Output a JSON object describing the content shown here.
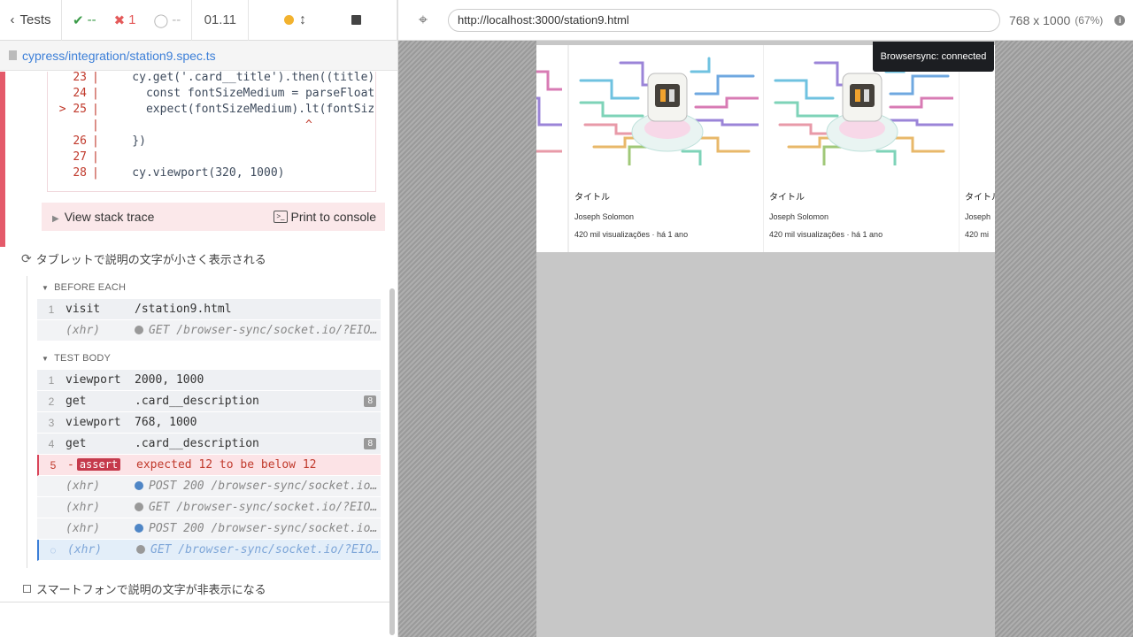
{
  "reporter": {
    "tests_label": "Tests",
    "passed": "--",
    "failed": "1",
    "pending": "--",
    "duration": "01.11",
    "spec_file": "cypress/integration/station9.spec.ts"
  },
  "error": {
    "code_lines": [
      {
        "num": "23",
        "arrow": "",
        "text": "    cy.get('.card__title').then((title)"
      },
      {
        "num": "24",
        "arrow": "",
        "text": "      const fontSizeMedium = parseFloat"
      },
      {
        "num": "25",
        "arrow": "> ",
        "text": "      expect(fontSizeMedium).lt(fontSiz"
      },
      {
        "num": "",
        "arrow": "",
        "text": "                             ^"
      },
      {
        "num": "26",
        "arrow": "",
        "text": "    })"
      },
      {
        "num": "27",
        "arrow": "",
        "text": ""
      },
      {
        "num": "28",
        "arrow": "",
        "text": "    cy.viewport(320, 1000)"
      }
    ],
    "stack_trace_label": "View stack trace",
    "print_console_label": "Print to console"
  },
  "test_title": "タブレットで説明の文字が小さく表示される",
  "before_each_label": "BEFORE EACH",
  "test_body_label": "TEST BODY",
  "before_each": [
    {
      "n": "1",
      "name": "visit",
      "msg": "/station9.html"
    },
    {
      "n": "",
      "name": "(xhr)",
      "msg": "GET /browser-sync/socket.io/?EIO=…",
      "dot": "gray"
    }
  ],
  "test_body": [
    {
      "n": "1",
      "name": "viewport",
      "msg": "2000, 1000"
    },
    {
      "n": "2",
      "name": "get",
      "msg": ".card__description",
      "badge": "8"
    },
    {
      "n": "3",
      "name": "viewport",
      "msg": "768, 1000"
    },
    {
      "n": "4",
      "name": "get",
      "msg": ".card__description",
      "badge": "8"
    }
  ],
  "assert": {
    "n": "5",
    "prefix": "-",
    "name": "assert",
    "msg": "expected 12 to be below 12"
  },
  "xhrs": [
    {
      "name": "(xhr)",
      "msg": "POST 200 /browser-sync/socket.io/…",
      "dot": "blue"
    },
    {
      "name": "(xhr)",
      "msg": "GET /browser-sync/socket.io/?EIO=…",
      "dot": "gray"
    },
    {
      "name": "(xhr)",
      "msg": "POST 200 /browser-sync/socket.io/…",
      "dot": "blue"
    },
    {
      "name": "(xhr)",
      "msg": "GET /browser-sync/socket.io/?EIO=…",
      "dot": "gray"
    }
  ],
  "next_test": "スマートフォンで説明の文字が非表示になる",
  "aut": {
    "url": "http://localhost:3000/station9.html",
    "viewport": "768 x 1000",
    "scale": "(67%)",
    "browsersync": "Browsersync: connected"
  },
  "cards": [
    {
      "title": "タイトル",
      "author": "Joseph Solomon",
      "views": "420 mil visualizações · há 1 ano"
    },
    {
      "title": "タイトル",
      "author": "Joseph Solomon",
      "views": "420 mil visualizações · há 1 ano"
    },
    {
      "title": "タイトル",
      "author": "Joseph",
      "views": "420 mi"
    }
  ],
  "colors": {
    "fail": "#e45a5a",
    "pass": "#3a9b48",
    "accent": "#3c7fd8"
  }
}
